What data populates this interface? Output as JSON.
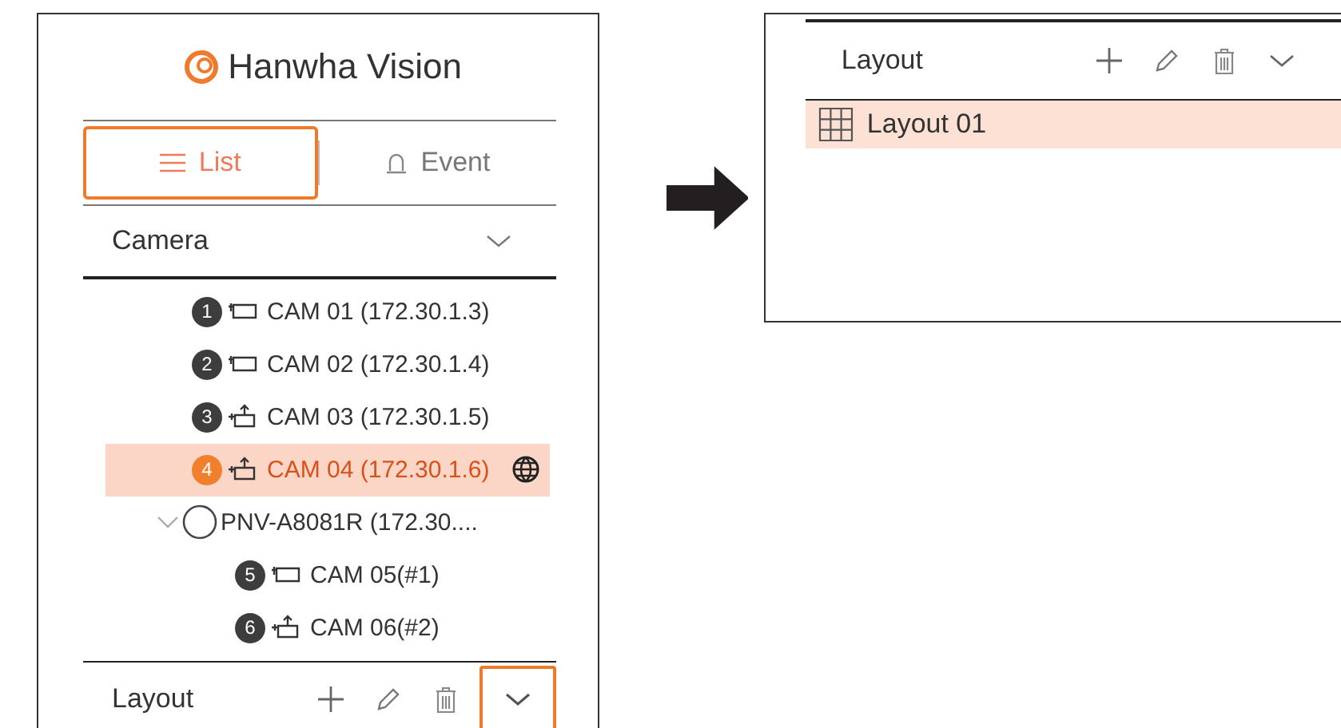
{
  "logo": {
    "text": "Hanwha Vision"
  },
  "tabs": [
    {
      "label": "List",
      "kind": "list",
      "selected": true,
      "outlined": true
    },
    {
      "label": "Event",
      "kind": "event",
      "selected": false,
      "outlined": false
    }
  ],
  "category": {
    "label": "Camera"
  },
  "tree": [
    {
      "kind": "fixed",
      "number": "1",
      "label": "CAM 01 (172.30.1.3)",
      "selected": false,
      "web": false
    },
    {
      "kind": "fixed",
      "number": "2",
      "label": "CAM 02 (172.30.1.4)",
      "selected": false,
      "web": false
    },
    {
      "kind": "ptz",
      "number": "3",
      "label": "CAM 03 (172.30.1.5)",
      "selected": false,
      "web": false
    },
    {
      "kind": "ptz",
      "number": "4",
      "label": "CAM 04 (172.30.1.6)",
      "selected": true,
      "web": true
    },
    {
      "kind": "group",
      "label": "PNV-A8081R (172.30....",
      "expanded": true,
      "children": [
        {
          "kind": "fixed",
          "number": "5",
          "label": "CAM 05(#1)",
          "selected": false,
          "web": false
        },
        {
          "kind": "ptz",
          "number": "6",
          "label": "CAM 06(#2)",
          "selected": false,
          "web": false
        }
      ]
    }
  ],
  "layout_bar": {
    "label": "Layout",
    "expanded": false,
    "buttons": [
      {
        "kind": "add",
        "outlined": false
      },
      {
        "kind": "edit",
        "outlined": false
      },
      {
        "kind": "delete",
        "outlined": false
      },
      {
        "kind": "expand",
        "outlined": true
      }
    ]
  },
  "expanded_layout": {
    "label": "Layout",
    "expanded": true,
    "buttons": [
      {
        "kind": "add",
        "outlined": false
      },
      {
        "kind": "edit",
        "outlined": false
      },
      {
        "kind": "delete",
        "outlined": false
      },
      {
        "kind": "expand",
        "outlined": false
      }
    ],
    "items": [
      {
        "label": "Layout 01",
        "selected": true
      }
    ]
  }
}
